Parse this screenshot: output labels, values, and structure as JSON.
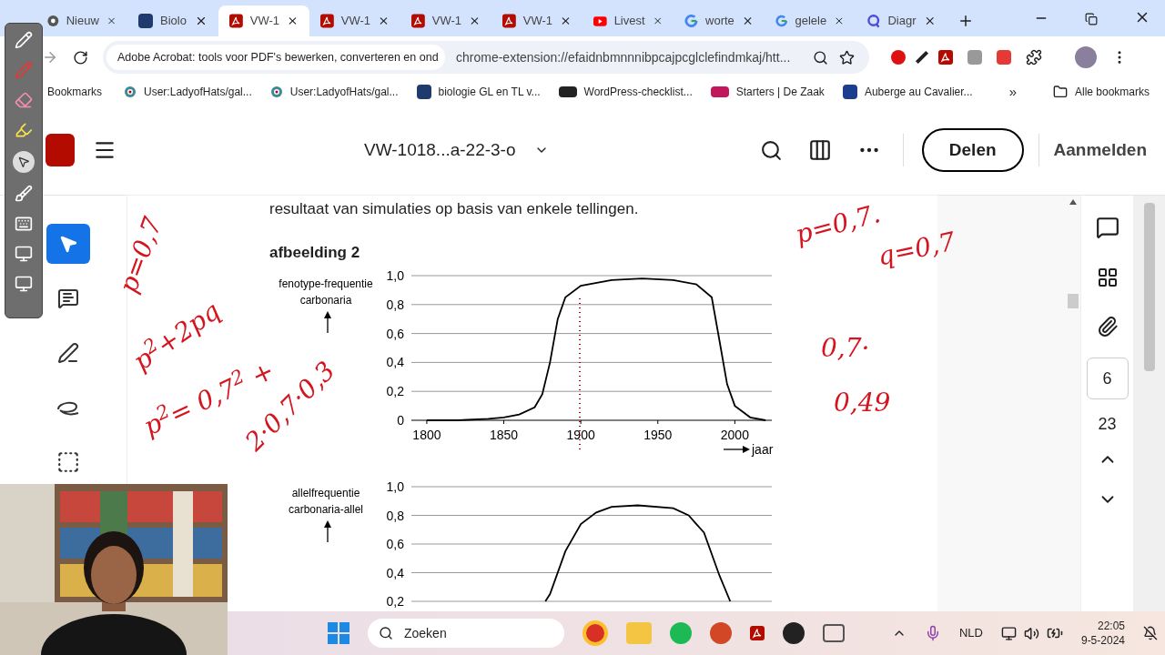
{
  "browser": {
    "tabs": [
      {
        "label": "Nieuw",
        "kind": "chrome",
        "selected": false
      },
      {
        "label": "Biolo",
        "kind": "crest",
        "selected": false
      },
      {
        "label": "VW-1",
        "kind": "pdf",
        "selected": true
      },
      {
        "label": "VW-1",
        "kind": "pdf",
        "selected": false
      },
      {
        "label": "VW-1",
        "kind": "pdf",
        "selected": false
      },
      {
        "label": "VW-1",
        "kind": "pdf",
        "selected": false
      },
      {
        "label": "Livest",
        "kind": "youtube",
        "selected": false
      },
      {
        "label": "worte",
        "kind": "google",
        "selected": false
      },
      {
        "label": "gelele",
        "kind": "google",
        "selected": false
      },
      {
        "label": "Diagr",
        "kind": "q",
        "selected": false
      }
    ],
    "site_chip": "Adobe Acrobat: tools voor PDF's bewerken, converteren en ond",
    "url": "chrome-extension://efaidnbmnnnibpcajpcglclefindmkaj/htt...",
    "bookmarks_label": "Bookmarks",
    "bookmarks": [
      {
        "label": "User:LadyofHats/gal...",
        "kind": "wiki"
      },
      {
        "label": "User:LadyofHats/gal...",
        "kind": "wiki"
      },
      {
        "label": "biologie GL en TL v...",
        "kind": "crest"
      },
      {
        "label": "WordPress-checklist...",
        "kind": "tip"
      },
      {
        "label": "Starters | De Zaak",
        "kind": "dz"
      },
      {
        "label": "Auberge au Cavalier...",
        "kind": "b"
      }
    ],
    "overflow": "»",
    "all_bookmarks": "Alle bookmarks"
  },
  "acrobat": {
    "title": "VW-1018...a-22-3-o",
    "share": "Delen",
    "sign_in": "Aanmelden",
    "tools": [
      {
        "kind": "select",
        "selected": true
      },
      {
        "kind": "comment",
        "selected": false
      },
      {
        "kind": "highlight",
        "selected": false
      },
      {
        "kind": "draw",
        "selected": false
      },
      {
        "kind": "text",
        "selected": false
      }
    ],
    "page_number": "6",
    "page_total": "23"
  },
  "document": {
    "text": "resultaat van simulaties op basis van enkele tellingen.",
    "figure_title": "afbeelding 2",
    "charts": [
      {
        "ylabel_lines": [
          "fenotype-frequentie",
          "carbonaria"
        ],
        "x_caption": "jaar",
        "chart_data": {
          "type": "line",
          "grid": true,
          "xlim": [
            1790,
            2024
          ],
          "ylim": [
            0,
            1
          ],
          "xticks": [
            1800,
            1850,
            1900,
            1950,
            2000
          ],
          "yticks": [
            {
              "value": 0,
              "label": "0"
            },
            {
              "value": 0.2,
              "label": "0,2"
            },
            {
              "value": 0.4,
              "label": "0,4"
            },
            {
              "value": 0.6,
              "label": "0,6"
            },
            {
              "value": 0.8,
              "label": "0,8"
            },
            {
              "value": 1,
              "label": "1,0"
            }
          ],
          "x": [
            1800,
            1820,
            1840,
            1850,
            1860,
            1870,
            1875,
            1880,
            1885,
            1890,
            1900,
            1920,
            1940,
            1960,
            1975,
            1985,
            1990,
            1995,
            2000,
            2010,
            2020
          ],
          "series": [
            {
              "color": "#000000",
              "values": [
                0,
                0,
                0.01,
                0.02,
                0.04,
                0.09,
                0.18,
                0.4,
                0.7,
                0.85,
                0.93,
                0.97,
                0.98,
                0.97,
                0.94,
                0.85,
                0.55,
                0.25,
                0.1,
                0.02,
                0
              ]
            }
          ]
        }
      },
      {
        "ylabel_lines": [
          "allelfrequentie",
          "carbonaria-allel"
        ],
        "chart_data": {
          "type": "line",
          "grid": true,
          "xlim": [
            1790,
            2024
          ],
          "ylim": [
            0.2,
            1
          ],
          "yticks": [
            {
              "value": 0.2,
              "label": "0,2"
            },
            {
              "value": 0.4,
              "label": "0,4"
            },
            {
              "value": 0.6,
              "label": "0,6"
            },
            {
              "value": 0.8,
              "label": "0,8"
            },
            {
              "value": 1,
              "label": "1,0"
            }
          ],
          "x": [
            1877,
            1880,
            1890,
            1900,
            1910,
            1920,
            1937,
            1960,
            1970,
            1980,
            1990,
            1997
          ],
          "series": [
            {
              "color": "#000000",
              "values": [
                0.2,
                0.25,
                0.55,
                0.74,
                0.82,
                0.86,
                0.87,
                0.85,
                0.8,
                0.68,
                0.38,
                0.2
              ]
            }
          ]
        }
      }
    ]
  },
  "ink": [
    {
      "text": "p=0,7"
    },
    {
      "text": "p$^{2}$+2pq"
    },
    {
      "text": "p$^{2}$= 0,7$^{2}$ +"
    },
    {
      "text": "2·0,7·0,3"
    },
    {
      "text": "p=0,7."
    },
    {
      "text": "q=0,7"
    },
    {
      "text": "0,7·"
    },
    {
      "text": "0,49"
    }
  ],
  "taskbar": {
    "search": "Zoeken",
    "language": "NLD",
    "time": "22:05",
    "date": "9-5-2024"
  }
}
